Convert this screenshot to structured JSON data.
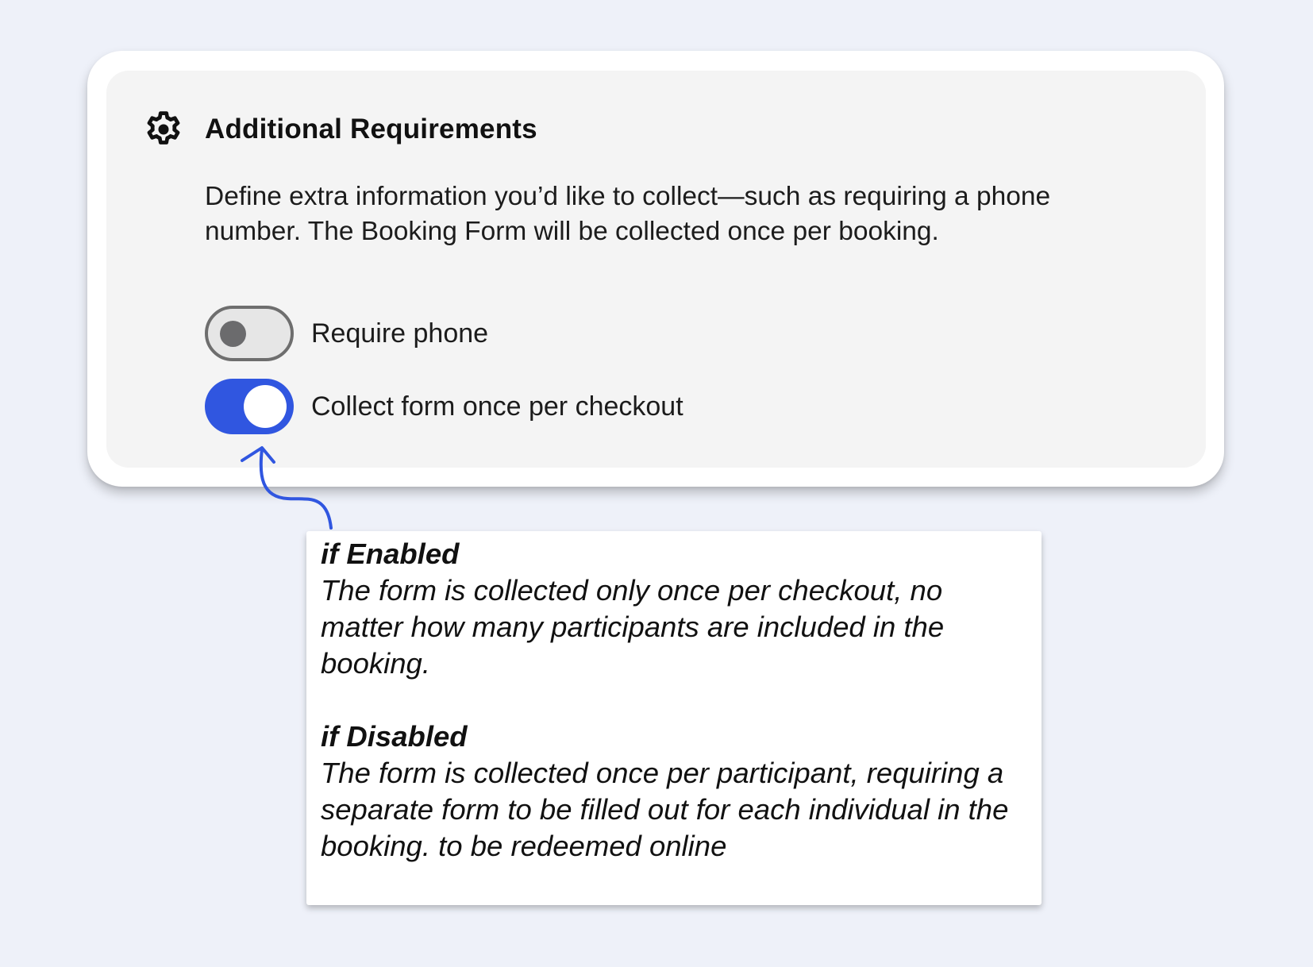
{
  "settings": {
    "title": "Additional Requirements",
    "description": "Define extra information you’d like to collect—such as requiring a phone number. The Booking Form will be collected once per booking.",
    "options": [
      {
        "label": "Require phone",
        "enabled": false
      },
      {
        "label": "Collect form once per checkout",
        "enabled": true
      }
    ]
  },
  "annotation": {
    "enabled_heading": "if Enabled",
    "enabled_text": "The form is collected only once per checkout, no matter how many participants are included in the booking.",
    "disabled_heading": "if Disabled",
    "disabled_text": "The form is collected once per participant, requiring a separate form to be filled out for each individual in the booking. to be redeemed online"
  },
  "colors": {
    "background": "#eef1f9",
    "accent": "#3056e0",
    "panel": "#f4f4f4"
  },
  "icons": {
    "header": "gear-icon",
    "callout": "curved-arrow-icon"
  }
}
